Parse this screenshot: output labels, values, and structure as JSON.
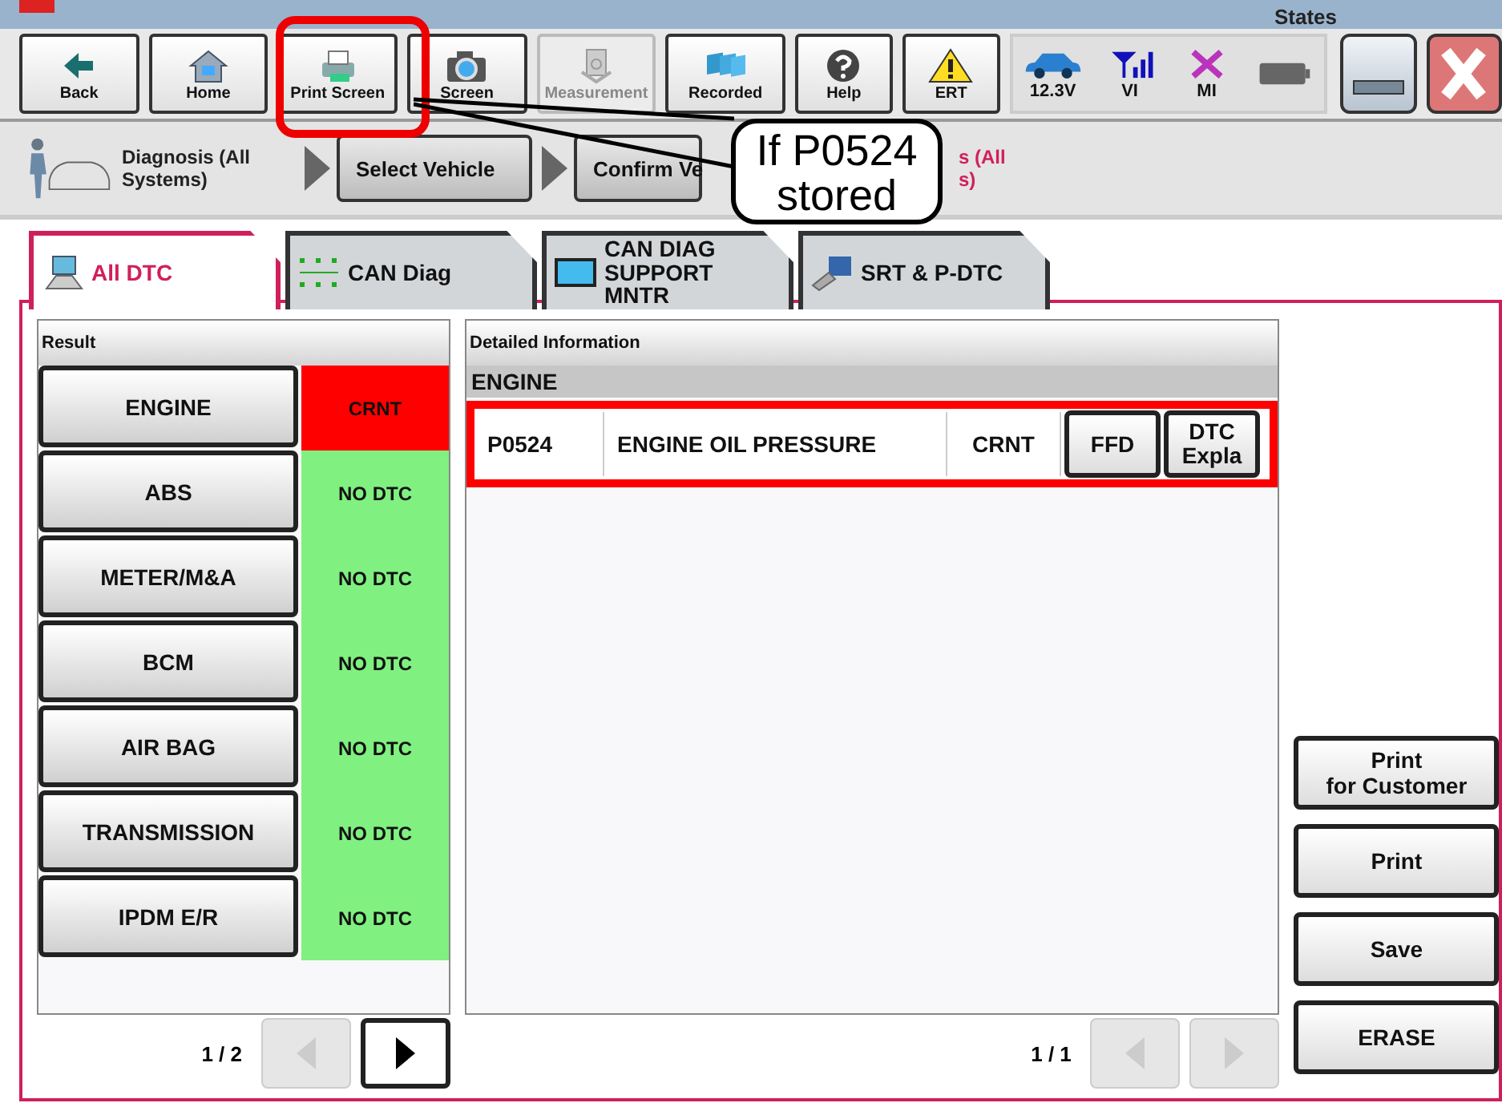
{
  "header": {
    "states_label": "States"
  },
  "toolbar": [
    {
      "label": "Back",
      "kind": "back",
      "disabled": false
    },
    {
      "label": "Home",
      "kind": "home",
      "disabled": false
    },
    {
      "label": "Print Screen",
      "kind": "printer",
      "disabled": false
    },
    {
      "label": "Screen",
      "kind": "camera",
      "disabled": false
    },
    {
      "label": "Measurement",
      "kind": "meter",
      "disabled": true
    },
    {
      "label": "Recorded",
      "kind": "folders",
      "disabled": false
    },
    {
      "label": "Help",
      "kind": "help",
      "disabled": false
    },
    {
      "label": "ERT",
      "kind": "warning",
      "disabled": false
    }
  ],
  "states": [
    {
      "kind": "car",
      "label": "12.3V"
    },
    {
      "kind": "signal",
      "label": "VI"
    },
    {
      "kind": "cross",
      "label": "MI"
    },
    {
      "kind": "battery"
    }
  ],
  "breadcrumb": [
    {
      "kind": "title",
      "label": "Diagnosis (All\nSystems)"
    },
    {
      "kind": "step",
      "label": "Select Vehicle"
    },
    {
      "kind": "step",
      "label": "Confirm Ve"
    },
    {
      "kind": "current",
      "label": "s (All\ns)"
    }
  ],
  "tabs": [
    {
      "label": "All DTC",
      "kind": "alldtc",
      "selected": true
    },
    {
      "label": "CAN Diag",
      "kind": "candiag",
      "selected": false
    },
    {
      "label": "CAN DIAG\nSUPPORT MNTR",
      "kind": "can",
      "selected": false
    },
    {
      "label": "SRT & P-DTC",
      "kind": "srt",
      "selected": false
    }
  ],
  "result": {
    "title": "Result",
    "page": "1 / 2",
    "prev_enabled": false,
    "next_enabled": true,
    "rows": [
      {
        "system": "ENGINE",
        "status": "CRNT",
        "color": "#ff0000"
      },
      {
        "system": "ABS",
        "status": "NO DTC",
        "color": "#80f080"
      },
      {
        "system": "METER/M&A",
        "status": "NO DTC",
        "color": "#80f080"
      },
      {
        "system": "BCM",
        "status": "NO DTC",
        "color": "#80f080"
      },
      {
        "system": "AIR BAG",
        "status": "NO DTC",
        "color": "#80f080"
      },
      {
        "system": "TRANSMISSION",
        "status": "NO DTC",
        "color": "#80f080"
      },
      {
        "system": "IPDM E/R",
        "status": "NO DTC",
        "color": "#80f080"
      }
    ]
  },
  "detail": {
    "title": "Detailed Information",
    "section": "ENGINE",
    "page": "1 / 1",
    "prev_enabled": false,
    "next_enabled": false,
    "rows": [
      {
        "code": "P0524",
        "description": "ENGINE OIL PRESSURE",
        "status": "CRNT",
        "highlighted": true,
        "buttons": [
          "FFD",
          "DTC\nExpla"
        ]
      }
    ]
  },
  "actions": [
    "Print\nfor Customer",
    "Print",
    "Save",
    "ERASE"
  ],
  "callout": {
    "text": "If P0524\nstored"
  }
}
